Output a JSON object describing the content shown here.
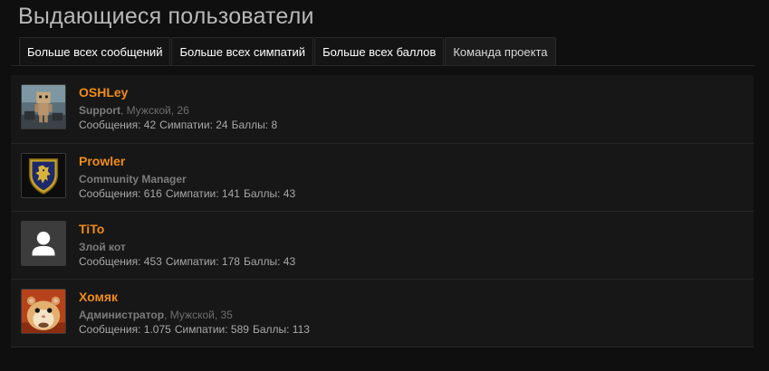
{
  "page": {
    "title": "Выдающиеся пользователи"
  },
  "tabs": [
    {
      "label": "Больше всех сообщений",
      "active": false
    },
    {
      "label": "Больше всех симпатий",
      "active": false
    },
    {
      "label": "Больше всех баллов",
      "active": false
    },
    {
      "label": "Команда проекта",
      "active": true
    }
  ],
  "users": [
    {
      "name": "OSHLey",
      "role": "Support",
      "extra": ", Мужской, 26",
      "avatar": "robot-avatar",
      "stats": {
        "messages": "Сообщения: 42",
        "likes": "Симпатии: 24",
        "points": "Баллы: 8"
      }
    },
    {
      "name": "Prowler",
      "role": "Community Manager",
      "extra": "",
      "avatar": "lion-shield-avatar",
      "stats": {
        "messages": "Сообщения: 616",
        "likes": "Симпатии: 141",
        "points": "Баллы: 43"
      }
    },
    {
      "name": "TiTo",
      "role": "Злой кот",
      "extra": "",
      "avatar": "default-user-avatar",
      "stats": {
        "messages": "Сообщения: 453",
        "likes": "Симпатии: 178",
        "points": "Баллы: 43"
      }
    },
    {
      "name": "Хомяк",
      "role": "Администратор",
      "extra": ", Мужской, 35",
      "avatar": "hamster-avatar",
      "stats": {
        "messages": "Сообщения: 1.075",
        "likes": "Симпатии: 589",
        "points": "Баллы: 113"
      }
    }
  ],
  "colors": {
    "background": "#0f0f0f",
    "panel": "#171717",
    "username": "#f08c1a",
    "role": "#7c7c7c",
    "stats": "#a8a8a8"
  }
}
